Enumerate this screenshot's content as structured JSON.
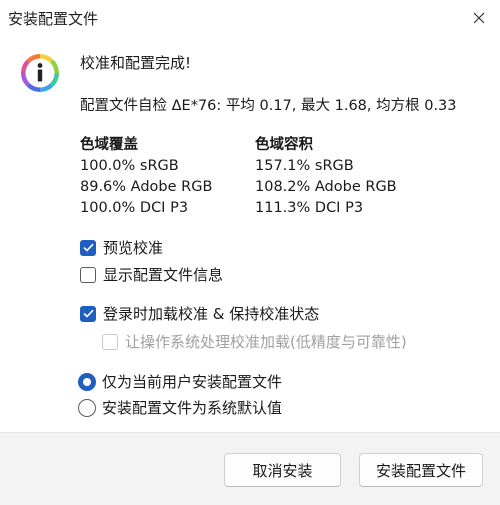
{
  "window": {
    "title": "安装配置文件",
    "close_glyph": "✕"
  },
  "message": {
    "heading": "校准和配置完成!",
    "delta_e": "配置文件自检 ΔE*76: 平均 0.17, 最大 1.68, 均方根 0.33"
  },
  "gamut": {
    "coverage": {
      "title": "色域覆盖",
      "rows": [
        "100.0% sRGB",
        "89.6% Adobe RGB",
        "100.0% DCI P3"
      ]
    },
    "volume": {
      "title": "色域容积",
      "rows": [
        "157.1% sRGB",
        "108.2% Adobe RGB",
        "111.3% DCI P3"
      ]
    }
  },
  "options": {
    "preview": {
      "label": "预览校准",
      "checked": true
    },
    "show_info": {
      "label": "显示配置文件信息",
      "checked": false
    },
    "load_on_login": {
      "label": "登录时加载校准 & 保持校准状态",
      "checked": true
    },
    "os_handle": {
      "label": "让操作系统处理校准加载(低精度与可靠性)",
      "checked": false,
      "disabled": true
    }
  },
  "install_scope": {
    "current_user": {
      "label": "仅为当前用户安装配置文件",
      "selected": true
    },
    "system_default": {
      "label": "安装配置文件为系统默认值",
      "selected": false
    }
  },
  "buttons": {
    "cancel": "取消安装",
    "install": "安装配置文件"
  },
  "colors": {
    "accent": "#1f5fbf",
    "footer_bg": "#f3f3f3"
  }
}
